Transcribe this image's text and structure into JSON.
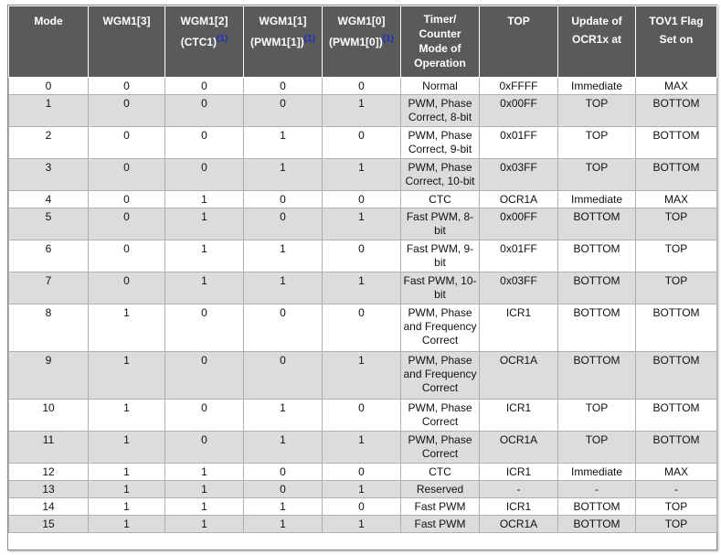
{
  "header": {
    "mode": "Mode",
    "wgm13": "WGM1[3]",
    "wgm12": [
      "WGM1[2]",
      "(CTC1)"
    ],
    "wgm11": [
      "WGM1[1]",
      "(PWM1[1])"
    ],
    "wgm10": [
      "WGM1[0]",
      "(PWM1[0])"
    ],
    "footnote": "(1)",
    "op": [
      "Timer/",
      "Counter",
      "Mode of",
      "Operation"
    ],
    "top": "TOP",
    "update": [
      "Update of",
      "OCR1x at"
    ],
    "tov": [
      "TOV1 Flag",
      "Set on"
    ]
  },
  "rows": [
    {
      "mode": "0",
      "w3": "0",
      "w2": "0",
      "w1": "0",
      "w0": "0",
      "op": [
        "Normal"
      ],
      "top": "0xFFFF",
      "update": "Immediate",
      "tov": "MAX"
    },
    {
      "mode": "1",
      "w3": "0",
      "w2": "0",
      "w1": "0",
      "w0": "1",
      "op": [
        "PWM, Phase",
        "Correct, 8-bit"
      ],
      "top": "0x00FF",
      "update": "TOP",
      "tov": "BOTTOM"
    },
    {
      "mode": "2",
      "w3": "0",
      "w2": "0",
      "w1": "1",
      "w0": "0",
      "op": [
        "PWM, Phase",
        "Correct, 9-bit"
      ],
      "top": "0x01FF",
      "update": "TOP",
      "tov": "BOTTOM"
    },
    {
      "mode": "3",
      "w3": "0",
      "w2": "0",
      "w1": "1",
      "w0": "1",
      "op": [
        "PWM, Phase",
        "Correct, 10-bit"
      ],
      "top": "0x03FF",
      "update": "TOP",
      "tov": "BOTTOM"
    },
    {
      "mode": "4",
      "w3": "0",
      "w2": "1",
      "w1": "0",
      "w0": "0",
      "op": [
        "CTC"
      ],
      "top": "OCR1A",
      "update": "Immediate",
      "tov": "MAX"
    },
    {
      "mode": "5",
      "w3": "0",
      "w2": "1",
      "w1": "0",
      "w0": "1",
      "op": [
        "Fast PWM, 8-",
        "bit"
      ],
      "top": "0x00FF",
      "update": "BOTTOM",
      "tov": "TOP"
    },
    {
      "mode": "6",
      "w3": "0",
      "w2": "1",
      "w1": "1",
      "w0": "0",
      "op": [
        "Fast PWM, 9-",
        "bit"
      ],
      "top": "0x01FF",
      "update": "BOTTOM",
      "tov": "TOP"
    },
    {
      "mode": "7",
      "w3": "0",
      "w2": "1",
      "w1": "1",
      "w0": "1",
      "op": [
        "Fast PWM, 10-",
        "bit"
      ],
      "top": "0x03FF",
      "update": "BOTTOM",
      "tov": "TOP"
    },
    {
      "mode": "8",
      "w3": "1",
      "w2": "0",
      "w1": "0",
      "w0": "0",
      "op": [
        "PWM, Phase",
        "and Frequency",
        "Correct"
      ],
      "top": "ICR1",
      "update": "BOTTOM",
      "tov": "BOTTOM"
    },
    {
      "mode": "9",
      "w3": "1",
      "w2": "0",
      "w1": "0",
      "w0": "1",
      "op": [
        "PWM, Phase",
        "and Frequency",
        "Correct"
      ],
      "top": "OCR1A",
      "update": "BOTTOM",
      "tov": "BOTTOM"
    },
    {
      "mode": "10",
      "w3": "1",
      "w2": "0",
      "w1": "1",
      "w0": "0",
      "op": [
        "PWM, Phase",
        "Correct"
      ],
      "top": "ICR1",
      "update": "TOP",
      "tov": "BOTTOM"
    },
    {
      "mode": "11",
      "w3": "1",
      "w2": "0",
      "w1": "1",
      "w0": "1",
      "op": [
        "PWM, Phase",
        "Correct"
      ],
      "top": "OCR1A",
      "update": "TOP",
      "tov": "BOTTOM"
    },
    {
      "mode": "12",
      "w3": "1",
      "w2": "1",
      "w1": "0",
      "w0": "0",
      "op": [
        "CTC"
      ],
      "top": "ICR1",
      "update": "Immediate",
      "tov": "MAX"
    },
    {
      "mode": "13",
      "w3": "1",
      "w2": "1",
      "w1": "0",
      "w0": "1",
      "op": [
        "Reserved"
      ],
      "top": "-",
      "update": "-",
      "tov": "-"
    },
    {
      "mode": "14",
      "w3": "1",
      "w2": "1",
      "w1": "1",
      "w0": "0",
      "op": [
        "Fast PWM"
      ],
      "top": "ICR1",
      "update": "BOTTOM",
      "tov": "TOP"
    },
    {
      "mode": "15",
      "w3": "1",
      "w2": "1",
      "w1": "1",
      "w0": "1",
      "op": [
        "Fast PWM"
      ],
      "top": "OCR1A",
      "update": "BOTTOM",
      "tov": "TOP"
    }
  ]
}
